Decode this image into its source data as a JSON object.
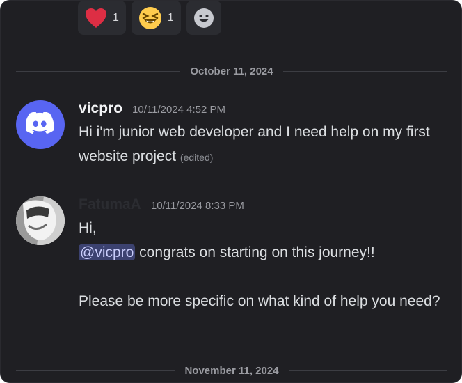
{
  "reactions": [
    {
      "emoji": "heart",
      "count": "1"
    },
    {
      "emoji": "laughing-face",
      "count": "1"
    },
    {
      "emoji": "add-reaction",
      "count": ""
    }
  ],
  "dividers": {
    "first": "October 11, 2024",
    "second": "November 11, 2024"
  },
  "messages": [
    {
      "username": "vicpro",
      "timestamp": "10/11/2024 4:52 PM",
      "text": "Hi i'm junior web developer and I need help on my first website project",
      "edited": "(edited)",
      "avatar": "discord-logo-icon"
    },
    {
      "username": "FatumaA",
      "timestamp": "10/11/2024 8:33 PM",
      "line1": "Hi,",
      "mention": "@vicpro",
      "line2_rest": " congrats on starting on this journey!!",
      "line3": "Please be more specific on what kind of help you need?",
      "avatar": "user-photo"
    }
  ],
  "colors": {
    "background": "#1f1f23",
    "mention_bg": "#3c4270",
    "discord_blurple": "#5865f2"
  }
}
